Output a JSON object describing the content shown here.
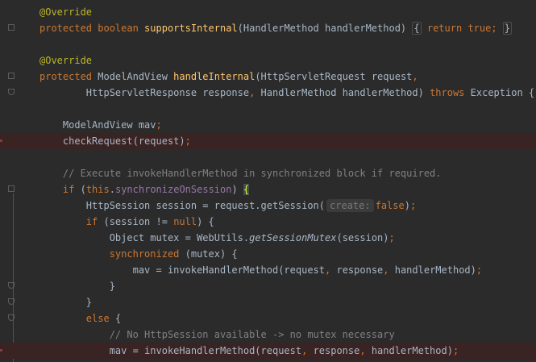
{
  "editor": {
    "lines": [
      {
        "tokens": [
          {
            "t": "@Override",
            "c": "an"
          }
        ]
      },
      {
        "tokens": [
          {
            "t": "protected ",
            "c": "kw"
          },
          {
            "t": "boolean ",
            "c": "kw"
          },
          {
            "t": "supportsInternal",
            "c": "fn"
          },
          {
            "t": "(HandlerMethod handlerMethod) "
          },
          {
            "t": "{",
            "c": "fold-box"
          },
          {
            "t": " "
          },
          {
            "t": "return ",
            "c": "kw"
          },
          {
            "t": "true",
            "c": "kw"
          },
          {
            "t": "; ",
            "c": "kw"
          },
          {
            "t": "}",
            "c": "fold-box"
          }
        ]
      },
      {
        "tokens": []
      },
      {
        "tokens": [
          {
            "t": "@Override",
            "c": "an"
          }
        ]
      },
      {
        "tokens": [
          {
            "t": "protected ",
            "c": "kw"
          },
          {
            "t": "ModelAndView "
          },
          {
            "t": "handleInternal",
            "c": "fn"
          },
          {
            "t": "(HttpServletRequest request"
          },
          {
            "t": ",",
            "c": "kw"
          }
        ]
      },
      {
        "tokens": [
          {
            "t": "        HttpServletResponse response"
          },
          {
            "t": ", ",
            "c": "kw"
          },
          {
            "t": "HandlerMethod handlerMethod) "
          },
          {
            "t": "throws ",
            "c": "kw"
          },
          {
            "t": "Exception {"
          }
        ]
      },
      {
        "tokens": []
      },
      {
        "tokens": [
          {
            "t": "    ModelAndView mav"
          },
          {
            "t": ";",
            "c": "kw"
          }
        ]
      },
      {
        "tokens": [
          {
            "t": "    checkRequest(request)"
          },
          {
            "t": ";",
            "c": "kw"
          }
        ]
      },
      {
        "tokens": []
      },
      {
        "tokens": [
          {
            "t": "    // Execute invokeHandlerMethod in synchronized block if required.",
            "c": "cm"
          }
        ]
      },
      {
        "tokens": [
          {
            "t": "    "
          },
          {
            "t": "if ",
            "c": "kw"
          },
          {
            "t": "("
          },
          {
            "t": "this",
            "c": "kw"
          },
          {
            "t": "."
          },
          {
            "t": "synchronizeOnSession",
            "c": "fld"
          },
          {
            "t": ") "
          },
          {
            "t": "{",
            "c": "brace-hl"
          }
        ]
      },
      {
        "tokens": [
          {
            "t": "        HttpSession session = request.getSession("
          },
          {
            "t": "create:",
            "c": "hint"
          },
          {
            "t": "false",
            "c": "kw"
          },
          {
            "t": ")"
          },
          {
            "t": ";",
            "c": "kw"
          }
        ]
      },
      {
        "tokens": [
          {
            "t": "        "
          },
          {
            "t": "if ",
            "c": "kw"
          },
          {
            "t": "(session != "
          },
          {
            "t": "null",
            "c": "kw"
          },
          {
            "t": ") {"
          }
        ]
      },
      {
        "tokens": [
          {
            "t": "            Object mutex = WebUtils."
          },
          {
            "t": "getSessionMutex",
            "c": "it"
          },
          {
            "t": "(session)"
          },
          {
            "t": ";",
            "c": "kw"
          }
        ]
      },
      {
        "tokens": [
          {
            "t": "            "
          },
          {
            "t": "synchronized ",
            "c": "kw"
          },
          {
            "t": "(mutex) {"
          }
        ]
      },
      {
        "tokens": [
          {
            "t": "                mav = invokeHandlerMethod(request"
          },
          {
            "t": ", ",
            "c": "kw"
          },
          {
            "t": "response"
          },
          {
            "t": ", ",
            "c": "kw"
          },
          {
            "t": "handlerMethod)"
          },
          {
            "t": ";",
            "c": "kw"
          }
        ]
      },
      {
        "tokens": [
          {
            "t": "            }"
          }
        ]
      },
      {
        "tokens": [
          {
            "t": "        }"
          }
        ]
      },
      {
        "tokens": [
          {
            "t": "        "
          },
          {
            "t": "else ",
            "c": "kw"
          },
          {
            "t": "{"
          }
        ]
      },
      {
        "tokens": [
          {
            "t": "            // No HttpSession available -> no mutex necessary",
            "c": "cm"
          }
        ]
      },
      {
        "tokens": [
          {
            "t": "            mav = invokeHandlerMethod(request"
          },
          {
            "t": ", ",
            "c": "kw"
          },
          {
            "t": "response"
          },
          {
            "t": ", ",
            "c": "kw"
          },
          {
            "t": "handlerMethod)"
          },
          {
            "t": ";",
            "c": "kw"
          }
        ]
      }
    ]
  }
}
